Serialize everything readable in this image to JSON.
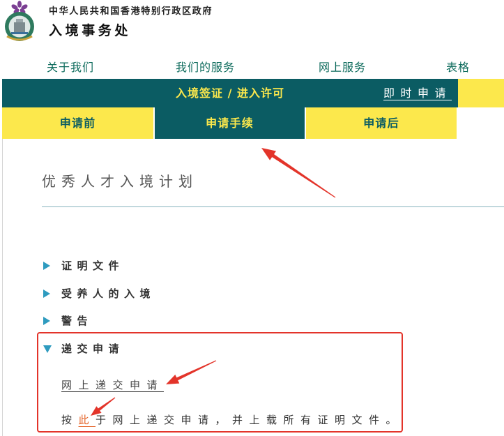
{
  "header": {
    "gov_name": "中华人民共和国香港特别行政区政府",
    "dept_name": "入境事务处",
    "logo_icon": "hk-immigration-emblem-icon"
  },
  "top_nav": {
    "items": [
      {
        "label": "关于我们"
      },
      {
        "label": "我们的服务"
      },
      {
        "label": "网上服务"
      },
      {
        "label": "表格"
      }
    ]
  },
  "section_bar": {
    "title": "入境签证 / 进入许可",
    "apply_now": "即时申请"
  },
  "tabs": [
    {
      "label": "申请前",
      "active": false
    },
    {
      "label": "申请手续",
      "active": true
    },
    {
      "label": "申请后",
      "active": false
    }
  ],
  "main": {
    "page_title": "优秀人才入境计划",
    "sections": [
      {
        "label": "证明文件",
        "expanded": false,
        "icon": "triangle-right-icon"
      },
      {
        "label": "受养人的入境",
        "expanded": false,
        "icon": "triangle-right-icon"
      },
      {
        "label": "警告",
        "expanded": false,
        "icon": "triangle-right-icon"
      },
      {
        "label": "递交申请",
        "expanded": true,
        "icon": "triangle-down-icon"
      }
    ],
    "submit": {
      "online_link": "网上递交申请",
      "instruction_prefix": "按",
      "instruction_link": "此",
      "instruction_suffix": "于网上递交申请，并上载所有证明文件。"
    }
  },
  "colors": {
    "teal": "#0b5c63",
    "yellow": "#fce84c",
    "nav_text": "#0d6b5c",
    "triangle": "#2e9bbf",
    "annotation_red": "#e3342a",
    "link_accent": "#e5652a"
  }
}
